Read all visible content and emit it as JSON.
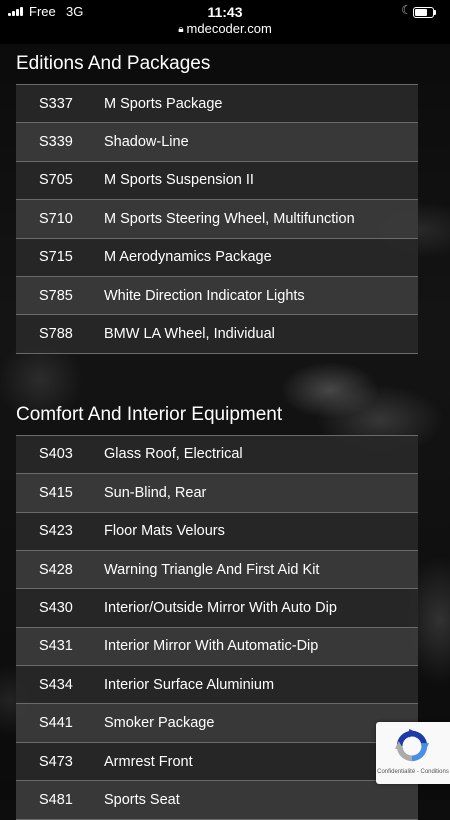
{
  "status_bar": {
    "carrier": "Free",
    "network": "3G",
    "time": "11:43",
    "url": "mdecoder.com"
  },
  "sections": [
    {
      "title": "Editions And Packages",
      "items": [
        {
          "code": "S337",
          "description": "M Sports Package"
        },
        {
          "code": "S339",
          "description": "Shadow-Line"
        },
        {
          "code": "S705",
          "description": "M Sports Suspension II"
        },
        {
          "code": "S710",
          "description": "M Sports Steering Wheel, Multifunction"
        },
        {
          "code": "S715",
          "description": "M Aerodynamics Package"
        },
        {
          "code": "S785",
          "description": "White Direction Indicator Lights"
        },
        {
          "code": "S788",
          "description": "BMW LA Wheel, Individual"
        }
      ]
    },
    {
      "title": "Comfort And Interior Equipment",
      "items": [
        {
          "code": "S403",
          "description": "Glass Roof, Electrical"
        },
        {
          "code": "S415",
          "description": "Sun-Blind, Rear"
        },
        {
          "code": "S423",
          "description": "Floor Mats Velours"
        },
        {
          "code": "S428",
          "description": "Warning Triangle And First Aid Kit"
        },
        {
          "code": "S430",
          "description": "Interior/Outside Mirror With Auto Dip"
        },
        {
          "code": "S431",
          "description": "Interior Mirror With Automatic-Dip"
        },
        {
          "code": "S434",
          "description": "Interior Surface Aluminium"
        },
        {
          "code": "S441",
          "description": "Smoker Package"
        },
        {
          "code": "S473",
          "description": "Armrest Front"
        },
        {
          "code": "S481",
          "description": "Sports Seat"
        }
      ]
    }
  ],
  "recaptcha": {
    "text": "Confidentialité - Conditions"
  },
  "icons": {
    "lock": "lock-icon",
    "moon": "moon-icon",
    "signal": "signal-icon",
    "battery": "battery-icon",
    "recaptcha": "recaptcha-icon"
  },
  "colors": {
    "row_dark": "#282828",
    "row_light": "#3a3a3a",
    "divider": "#6a6a6a",
    "text": "#ffffff"
  }
}
